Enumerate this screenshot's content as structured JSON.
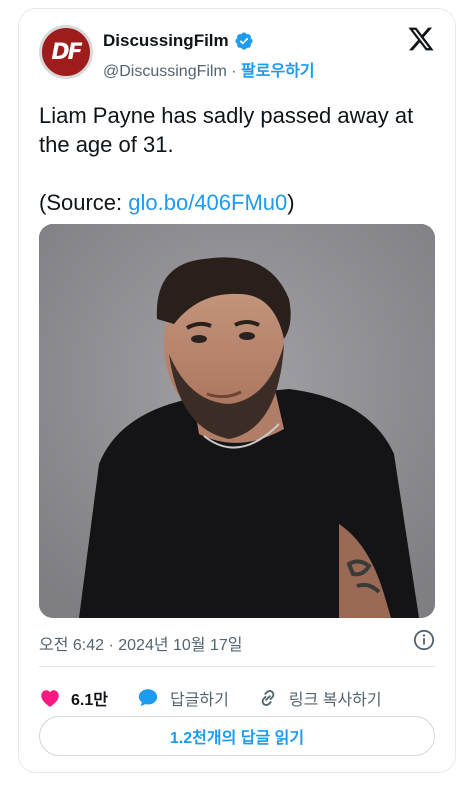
{
  "author": {
    "display_name": "DiscussingFilm",
    "handle": "@DiscussingFilm",
    "separator": " · ",
    "follow_label": "팔로우하기",
    "avatar_text": "DF"
  },
  "tweet": {
    "text_line": "Liam Payne has sadly passed away at the age of 31.",
    "source_prefix": "(Source: ",
    "source_link": "glo.bo/406FMu0",
    "source_suffix": ")"
  },
  "meta": {
    "timestamp": "오전 6:42 · 2024년 10월 17일"
  },
  "actions": {
    "likes": "6.1만",
    "reply": "답글하기",
    "copy_link": "링크 복사하기"
  },
  "read_replies_label": "1.2천개의 답글 읽기",
  "colors": {
    "accent": "#1d9bf0",
    "like": "#f91880",
    "avatar_bg": "#9e1c1c"
  }
}
